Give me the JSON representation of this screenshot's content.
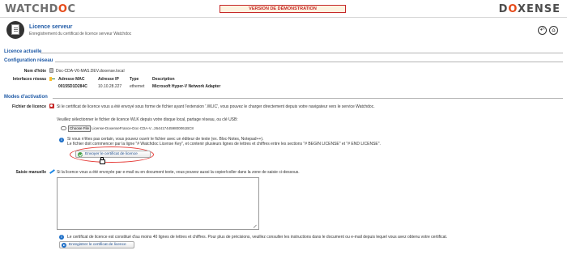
{
  "brand": {
    "left_logo_main": "WATCHD",
    "left_logo_accent": "O",
    "left_logo_tail": "C",
    "right_logo_main": "D",
    "right_logo_accent": "O",
    "right_logo_tail": "XENSE",
    "accent_color": "#e64a19"
  },
  "demo_banner": "VERSION DE DÉMONSTRATION",
  "header": {
    "title": "Licence serveur",
    "subtitle": "Enregistrement du certificat de licence serveur Watchdoc",
    "icon": "license-document-icon",
    "back_icon": "back-arrow-icon",
    "home_icon": "home-icon"
  },
  "sections": {
    "licence_actuelle": "Licence actuelle",
    "configuration_reseau": "Configuration réseau",
    "modes_activation": "Modes d'activation"
  },
  "network": {
    "hostname_label": "Nom d'hôte",
    "hostname_value": "Doc-CDA-V6-MAS.DEV.doxense.local",
    "interfaces_label": "Interfaces réseau",
    "columns": [
      "Adresse MAC",
      "Adresse IP",
      "Type",
      "Description"
    ],
    "rows": [
      [
        "00155D1D284C",
        "10.10.28.227",
        "ethernet",
        "Microsoft Hyper-V Network Adapter"
      ]
    ]
  },
  "activation": {
    "fichier_label": "Fichier de licence",
    "fichier_intro": "Si le certificat de licence vous a été envoyé sous forme de fichier ayant l'extension '.WLIC', vous pouvez le charger directement depuis votre navigateur vers le service Watchdoc.",
    "select_text": "Veuillez sélectionner le fichier de licence WLK depuis votre disque local, partage réseau, ou clé USB:",
    "file_button": "Choose File",
    "file_name": "License-DoxenseFrance-Doc-CDA-V...2644174459800061BC898855.wlk",
    "note_line1": "Si vous n'êtes pas certain, vous pouvez ouvrir le fichier avec un éditeur de texte (ex. Bloc-Notes, Notepad++).",
    "note_line2": "Le fichier doit commencer par la ligne \"# Watchdoc License Key\", et contenir plusieurs lignes de lettres et chiffres entre les sections \"# BEGIN LICENSE\" et \"# END LICENSE\".",
    "send_button": "Envoyer le certificat de licence",
    "saisie_label": "Saisie manuelle",
    "saisie_intro": "Si la licence vous a été envoyée par e-mail ou en document texte, vous pouvez aussi la copier/coller dans la zone de saisie ci-dessous.",
    "manual_value": "",
    "manual_note": "Le certificat de licence est constitué d'au moins 40 lignes de lettres et chiffres. Pour plus de précisions, veuillez consulter les instructions dans le document ou e-mail depuis lequel vous avez obtenu votre certificat.",
    "save_button": "Enregistrer le certificat de licence"
  }
}
